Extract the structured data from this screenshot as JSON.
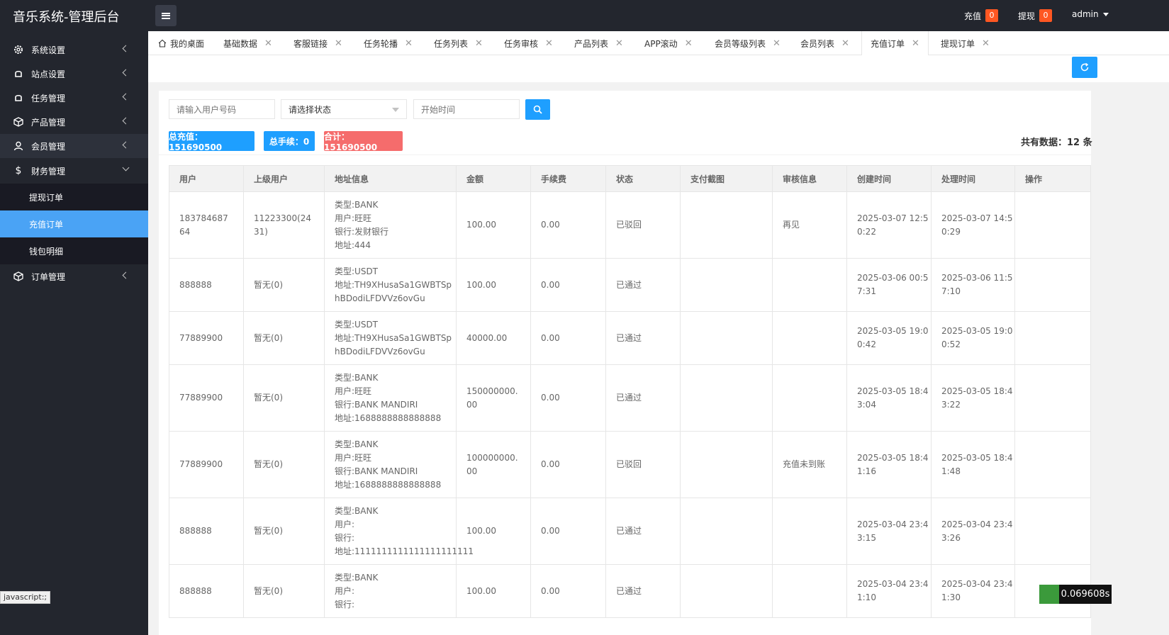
{
  "app": {
    "title": "音乐系统-管理后台",
    "top": {
      "recharge_label": "充值",
      "recharge_count": "0",
      "withdraw_label": "提现",
      "withdraw_count": "0",
      "user": "admin"
    }
  },
  "sidebar": {
    "items": [
      {
        "label": "系统设置",
        "icon": "gear-icon"
      },
      {
        "label": "站点设置",
        "icon": "shield-icon"
      },
      {
        "label": "任务管理",
        "icon": "shield-icon"
      },
      {
        "label": "产品管理",
        "icon": "cube-icon"
      },
      {
        "label": "会员管理",
        "icon": "user-icon"
      },
      {
        "label": "财务管理",
        "icon": "dollar-icon"
      },
      {
        "label": "订单管理",
        "icon": "cube-icon"
      }
    ],
    "sub_items": [
      {
        "label": "提现订单"
      },
      {
        "label": "充值订单"
      },
      {
        "label": "钱包明细"
      }
    ]
  },
  "tabs": [
    {
      "label": "我的桌面"
    },
    {
      "label": "基础数据"
    },
    {
      "label": "客服链接"
    },
    {
      "label": "任务轮播"
    },
    {
      "label": "任务列表"
    },
    {
      "label": "任务审核"
    },
    {
      "label": "产品列表"
    },
    {
      "label": "APP滚动"
    },
    {
      "label": "会员等级列表"
    },
    {
      "label": "会员列表"
    },
    {
      "label": "充值订单"
    },
    {
      "label": "提现订单"
    }
  ],
  "filters": {
    "user_placeholder": "请输入用户号码",
    "status_value": "请选择状态",
    "start_placeholder": "开始时间"
  },
  "stats": {
    "total_recharge": "总充值：151690500",
    "total_fee": "总手续：0",
    "sum": "合计：151690500",
    "total_count": "共有数据：12 条"
  },
  "table": {
    "headers": [
      "用户",
      "上级用户",
      "地址信息",
      "金额",
      "手续费",
      "状态",
      "支付截图",
      "审核信息",
      "创建时间",
      "处理时间",
      "操作"
    ],
    "rows": [
      {
        "user": "18378468764",
        "parent": "11223300(2431)",
        "addr": [
          "类型:BANK",
          "用户:旺旺",
          "银行:发财银行",
          "地址:444"
        ],
        "amount": "100.00",
        "fee": "0.00",
        "status": "已驳回",
        "shot": "",
        "review": "再见",
        "created": [
          "2025-03-07 12:5",
          "0:22"
        ],
        "handled": [
          "2025-03-07 14:5",
          "0:29"
        ],
        "op": ""
      },
      {
        "user": "888888",
        "parent": "暂无(0)",
        "addr": [
          "类型:USDT",
          "地址:TH9XHusaSa1GWBTSp",
          "hBDodiLFDVVz6ovGu"
        ],
        "amount": "100.00",
        "fee": "0.00",
        "status": "已通过",
        "shot": "",
        "review": "",
        "created": [
          "2025-03-06 00:5",
          "7:31"
        ],
        "handled": [
          "2025-03-06 11:5",
          "7:10"
        ],
        "op": ""
      },
      {
        "user": "77889900",
        "parent": "暂无(0)",
        "addr": [
          "类型:USDT",
          "地址:TH9XHusaSa1GWBTSp",
          "hBDodiLFDVVz6ovGu"
        ],
        "amount": "40000.00",
        "fee": "0.00",
        "status": "已通过",
        "shot": "",
        "review": "",
        "created": [
          "2025-03-05 19:0",
          "0:42"
        ],
        "handled": [
          "2025-03-05 19:0",
          "0:52"
        ],
        "op": ""
      },
      {
        "user": "77889900",
        "parent": "暂无(0)",
        "addr": [
          "类型:BANK",
          "用户:旺旺",
          "银行:BANK MANDIRI",
          "地址:1688888888888888"
        ],
        "amount": "150000000.00",
        "fee": "0.00",
        "status": "已通过",
        "shot": "",
        "review": "",
        "created": [
          "2025-03-05 18:4",
          "3:04"
        ],
        "handled": [
          "2025-03-05 18:4",
          "3:22"
        ],
        "op": ""
      },
      {
        "user": "77889900",
        "parent": "暂无(0)",
        "addr": [
          "类型:BANK",
          "用户:旺旺",
          "银行:BANK MANDIRI",
          "地址:1688888888888888"
        ],
        "amount": "100000000.00",
        "fee": "0.00",
        "status": "已驳回",
        "shot": "",
        "review": "充值未到账",
        "created": [
          "2025-03-05 18:4",
          "1:16"
        ],
        "handled": [
          "2025-03-05 18:4",
          "1:48"
        ],
        "op": ""
      },
      {
        "user": "888888",
        "parent": "暂无(0)",
        "addr": [
          "类型:BANK",
          "用户:",
          "银行:",
          "地址:1111111111111111111111"
        ],
        "amount": "100.00",
        "fee": "0.00",
        "status": "已通过",
        "shot": "",
        "review": "",
        "created": [
          "2025-03-04 23:4",
          "3:15"
        ],
        "handled": [
          "2025-03-04 23:4",
          "3:26"
        ],
        "op": ""
      },
      {
        "user": "888888",
        "parent": "暂无(0)",
        "addr": [
          "类型:BANK",
          "用户:",
          "银行:"
        ],
        "amount": "100.00",
        "fee": "0.00",
        "status": "已通过",
        "shot": "",
        "review": "",
        "created": [
          "2025-03-04 23:4",
          "1:10"
        ],
        "handled": [
          "2025-03-04 23:4",
          "1:30"
        ],
        "op": ""
      }
    ]
  },
  "statusbar": {
    "link": "javascript:;",
    "timer": "0.069608s"
  },
  "colors": {
    "sidebar": "#23262e",
    "active": "#4aa3f5",
    "primary": "#1e9fff",
    "danger": "#ff5722",
    "sum": "#f56c6c"
  }
}
